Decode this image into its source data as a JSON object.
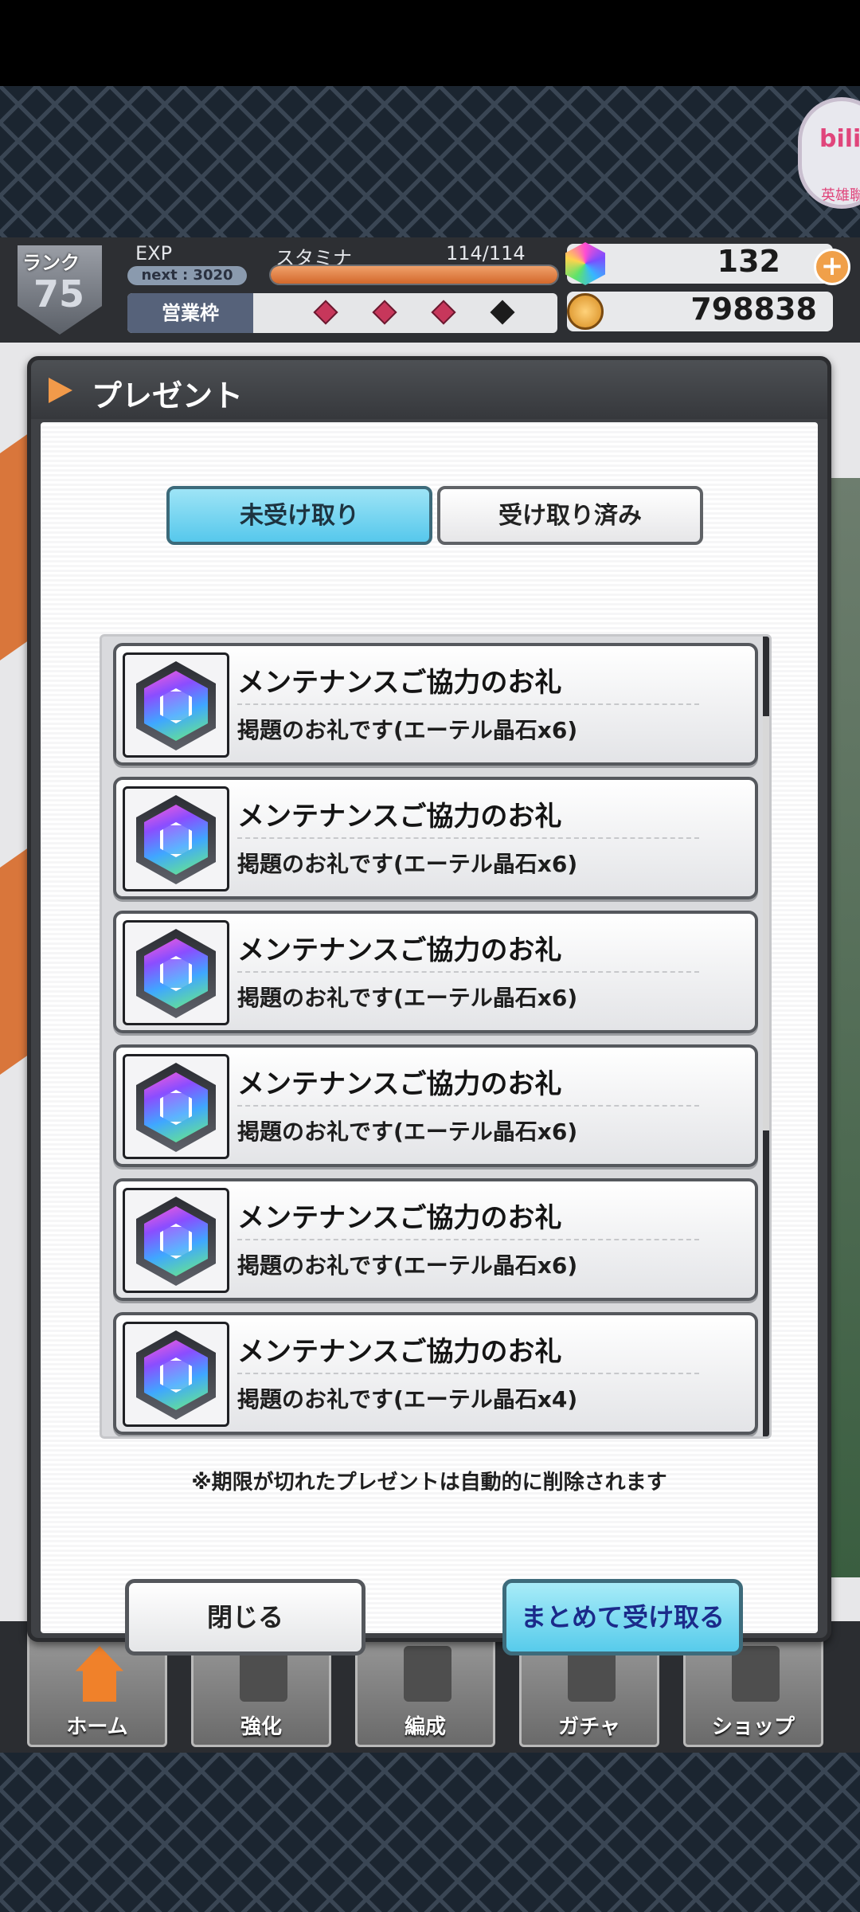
{
  "status": {
    "rank_label": "ランク",
    "rank_value": "75",
    "exp_label": "EXP",
    "exp_next": "next : 3020",
    "stamina_label": "スタミナ",
    "stamina_value": "114/114",
    "stamina_fraction": 1.0,
    "eigyo_label": "営業枠",
    "eigyo_slots": [
      true,
      true,
      true,
      false
    ],
    "gems": "132",
    "coins": "798838",
    "plus": "+"
  },
  "bili": {
    "logo": "bili",
    "sub": "英雄聯"
  },
  "modal": {
    "title": "プレゼント",
    "tabs": [
      {
        "label": "未受け取り",
        "active": true
      },
      {
        "label": "受け取り済み",
        "active": false
      }
    ],
    "items": [
      {
        "title": "メンテナンスご協力のお礼",
        "desc": "掲題のお礼です(エーテル晶石x6)"
      },
      {
        "title": "メンテナンスご協力のお礼",
        "desc": "掲題のお礼です(エーテル晶石x6)"
      },
      {
        "title": "メンテナンスご協力のお礼",
        "desc": "掲題のお礼です(エーテル晶石x6)"
      },
      {
        "title": "メンテナンスご協力のお礼",
        "desc": "掲題のお礼です(エーテル晶石x6)"
      },
      {
        "title": "メンテナンスご協力のお礼",
        "desc": "掲題のお礼です(エーテル晶石x6)"
      },
      {
        "title": "メンテナンスご協力のお礼",
        "desc": "掲題のお礼です(エーテル晶石x4)"
      }
    ],
    "note": "※期限が切れたプレゼントは自動的に削除されます",
    "close_label": "閉じる",
    "receive_all_label": "まとめて受け取る"
  },
  "nav": {
    "items": [
      {
        "label": "ホーム",
        "icon": "home-icon"
      },
      {
        "label": "強化",
        "icon": "dumbbell-icon"
      },
      {
        "label": "編成",
        "icon": "team-icon"
      },
      {
        "label": "ガチャ",
        "icon": "atom-icon"
      },
      {
        "label": "ショップ",
        "icon": "shop-icon"
      }
    ]
  },
  "colors": {
    "accent": "#56c8ec",
    "orange": "#f29a4a",
    "slot_on": "#c7375b"
  }
}
